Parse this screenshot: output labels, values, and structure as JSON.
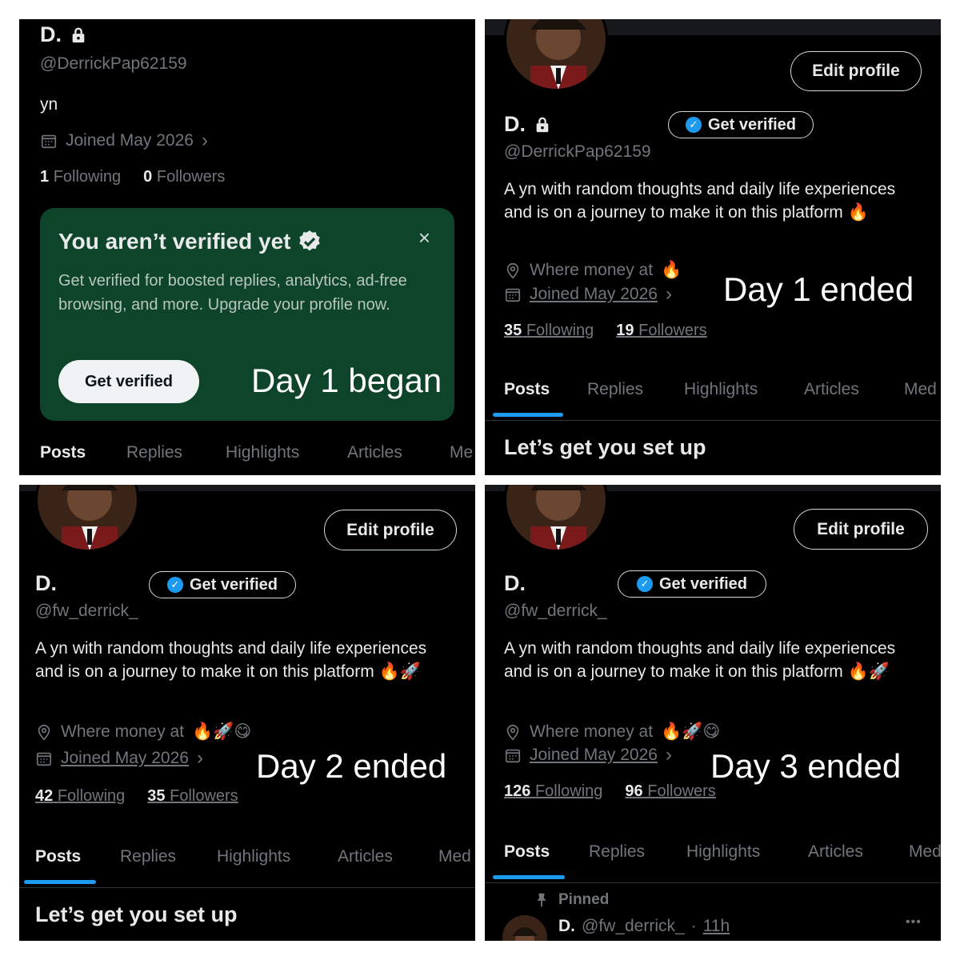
{
  "panels": {
    "p1": {
      "name": "D.",
      "handle": "@DerrickPap62159",
      "bio": "yn",
      "joined": "Joined May 2026",
      "following_count": "1",
      "following_label": "Following",
      "followers_count": "0",
      "followers_label": "Followers",
      "card": {
        "title": "You aren’t verified yet",
        "body": "Get verified for boosted replies, analytics, ad-free browsing, and more. Upgrade your profile now.",
        "close": "×",
        "button": "Get verified"
      },
      "overlay": "Day 1 began",
      "tabs": [
        "Posts",
        "Replies",
        "Highlights",
        "Articles",
        "Me"
      ]
    },
    "p2": {
      "edit_profile": "Edit profile",
      "name": "D.",
      "get_verified": "Get verified",
      "handle": "@DerrickPap62159",
      "bio": "A yn with random thoughts and daily life experiences and is on a journey to make it on this platform",
      "bio_emoji": "🔥",
      "location": "Where money at",
      "location_emoji": "🔥",
      "joined": "Joined May 2026",
      "following_count": "35",
      "following_label": "Following",
      "followers_count": "19",
      "followers_label": "Followers",
      "overlay": "Day 1 ended",
      "tabs": [
        "Posts",
        "Replies",
        "Highlights",
        "Articles",
        "Med"
      ],
      "section": "Let’s get you set up"
    },
    "p3": {
      "edit_profile": "Edit profile",
      "name": "D.",
      "get_verified": "Get verified",
      "handle": "@fw_derrick_",
      "bio": "A yn with random thoughts and daily life experiences and is on a journey to make it on this platform",
      "bio_emoji": "🔥🚀",
      "location": "Where money at",
      "location_emoji": "🔥🚀😋",
      "joined": "Joined May 2026",
      "following_count": "42",
      "following_label": "Following",
      "followers_count": "35",
      "followers_label": "Followers",
      "overlay": "Day 2 ended",
      "tabs": [
        "Posts",
        "Replies",
        "Highlights",
        "Articles",
        "Med"
      ],
      "section": "Let’s get you set up"
    },
    "p4": {
      "edit_profile": "Edit profile",
      "name": "D.",
      "get_verified": "Get verified",
      "handle": "@fw_derrick_",
      "bio": "A yn with random thoughts and daily life experiences and is on a journey to make it on this platform",
      "bio_emoji": "🔥🚀",
      "location": "Where money at",
      "location_emoji": "🔥🚀😋",
      "joined": "Joined May 2026",
      "following_count": "126",
      "following_label": "Following",
      "followers_count": "96",
      "followers_label": "Followers",
      "overlay": "Day 3 ended",
      "tabs": [
        "Posts",
        "Replies",
        "Highlights",
        "Articles",
        "Med"
      ],
      "pinned": "Pinned",
      "post_name": "D.",
      "post_handle": "@fw_derrick_",
      "post_time": "11h",
      "post_more": "•••"
    }
  },
  "colors": {
    "background": "#000000",
    "accent": "#1d9bf0",
    "card": "#0e4429",
    "muted": "#71767b",
    "text": "#e7e9ea"
  },
  "icons": [
    "lock-icon",
    "verified-badge-icon",
    "calendar-icon",
    "chevron-right-icon",
    "location-pin-icon",
    "close-icon",
    "pin-icon",
    "more-icon"
  ]
}
